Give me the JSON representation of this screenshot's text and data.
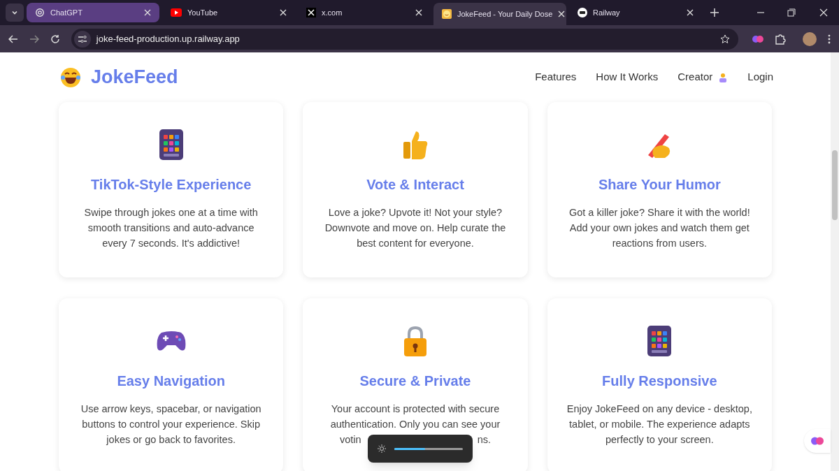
{
  "browser": {
    "tabs": [
      {
        "title": "ChatGPT",
        "selected": false,
        "hovered": true
      },
      {
        "title": "YouTube",
        "selected": false,
        "hovered": false
      },
      {
        "title": "x.com",
        "selected": false,
        "hovered": false
      },
      {
        "title": "JokeFeed - Your Daily Dose",
        "selected": true,
        "hovered": false
      },
      {
        "title": "Railway",
        "selected": false,
        "hovered": false
      }
    ],
    "url": "joke-feed-production.up.railway.app"
  },
  "header": {
    "logo": "JokeFeed",
    "nav": [
      {
        "label": "Features",
        "kind": "text"
      },
      {
        "label": "How It Works",
        "kind": "text"
      },
      {
        "label": "Creator",
        "kind": "creator"
      },
      {
        "label": "Login",
        "kind": "text"
      }
    ]
  },
  "features": [
    {
      "title": "TikTok-Style Experience",
      "lines": [
        "Swipe through jokes one at a time with",
        "smooth transitions and auto-advance",
        "every 7 seconds. It's addictive!"
      ]
    },
    {
      "title": "Vote & Interact",
      "lines": [
        "Love a joke? Upvote it! Not your style?",
        "Downvote and move on. Help curate the",
        "best content for everyone."
      ]
    },
    {
      "title": "Share Your Humor",
      "lines": [
        "Got a killer joke? Share it with the world!",
        "Add your own jokes and watch them get",
        "reactions from users."
      ]
    },
    {
      "title": "Easy Navigation",
      "lines": [
        "Use arrow keys, spacebar, or navigation",
        "buttons to control your experience. Skip",
        "jokes or go back to favorites."
      ]
    },
    {
      "title": "Secure & Private",
      "lines": [
        "Your account is protected with secure",
        "authentication. Only you can see your"
      ],
      "covered_line": {
        "left": "votin",
        "right": "ns."
      }
    },
    {
      "title": "Fully Responsive",
      "lines": [
        "Enjoy JokeFeed on any device - desktop,",
        "tablet, or mobile. The experience adapts",
        "perfectly to your screen."
      ]
    }
  ],
  "brightness": {
    "level": 0.45
  }
}
